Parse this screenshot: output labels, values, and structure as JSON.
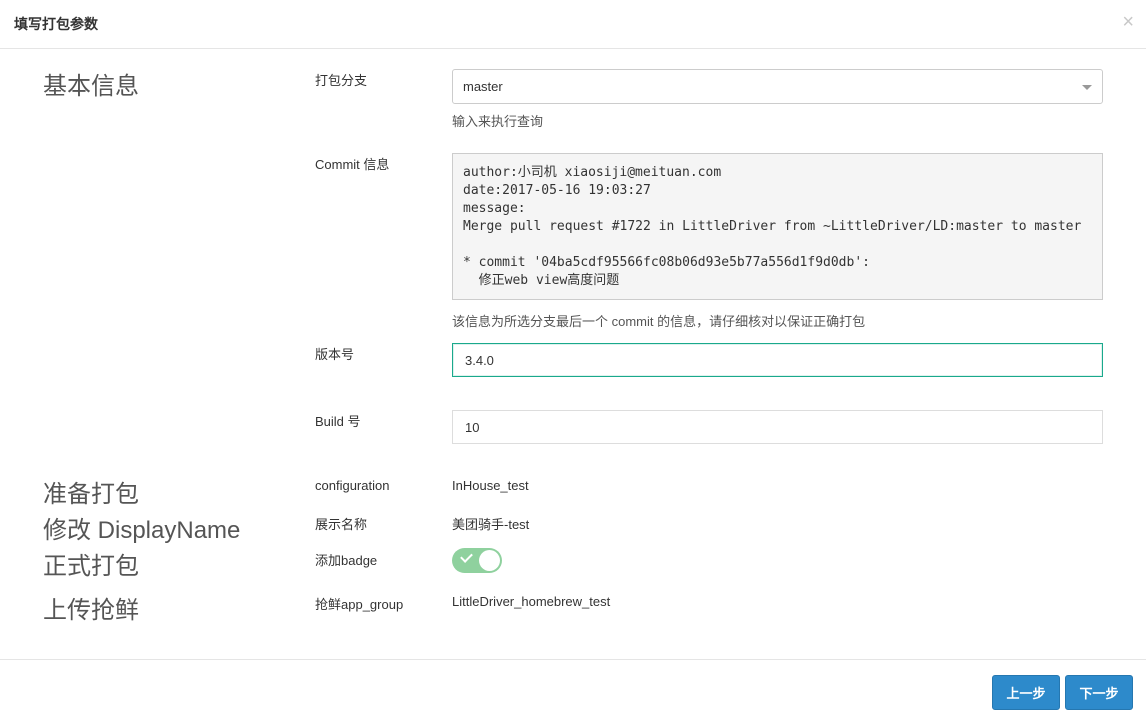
{
  "header": {
    "title": "填写打包参数",
    "close_glyph": "×"
  },
  "sections": {
    "basic_info": "基本信息",
    "prepare": "准备打包",
    "modify_display_name": "修改 DisplayName",
    "formal_package": "正式打包",
    "upload": "上传抢鲜"
  },
  "form": {
    "branch": {
      "label": "打包分支",
      "value": "master",
      "help": "输入来执行查询"
    },
    "commit": {
      "label": "Commit 信息",
      "text": "author:小司机 xiaosiji@meituan.com\ndate:2017-05-16 19:03:27\nmessage:\nMerge pull request #1722 in LittleDriver from ~LittleDriver/LD:master to master\n\n* commit '04ba5cdf95566fc08b06d93e5b77a556d1f9d0db':\n  修正web view高度问题",
      "help": "该信息为所选分支最后一个 commit 的信息，请仔细核对以保证正确打包"
    },
    "version": {
      "label": "版本号",
      "value": "3.4.0"
    },
    "build": {
      "label": "Build 号",
      "value": "10"
    },
    "configuration": {
      "label": "configuration",
      "value": "InHouse_test"
    },
    "display_name": {
      "label": "展示名称",
      "value": "美团骑手-test"
    },
    "badge": {
      "label": "添加badge",
      "enabled": true,
      "color": "#8fd19e"
    },
    "app_group": {
      "label": "抢鲜app_group",
      "value": "LittleDriver_homebrew_test"
    }
  },
  "footer": {
    "prev_label": "上一步",
    "next_label": "下一步",
    "button_color": "#2d8acb"
  }
}
